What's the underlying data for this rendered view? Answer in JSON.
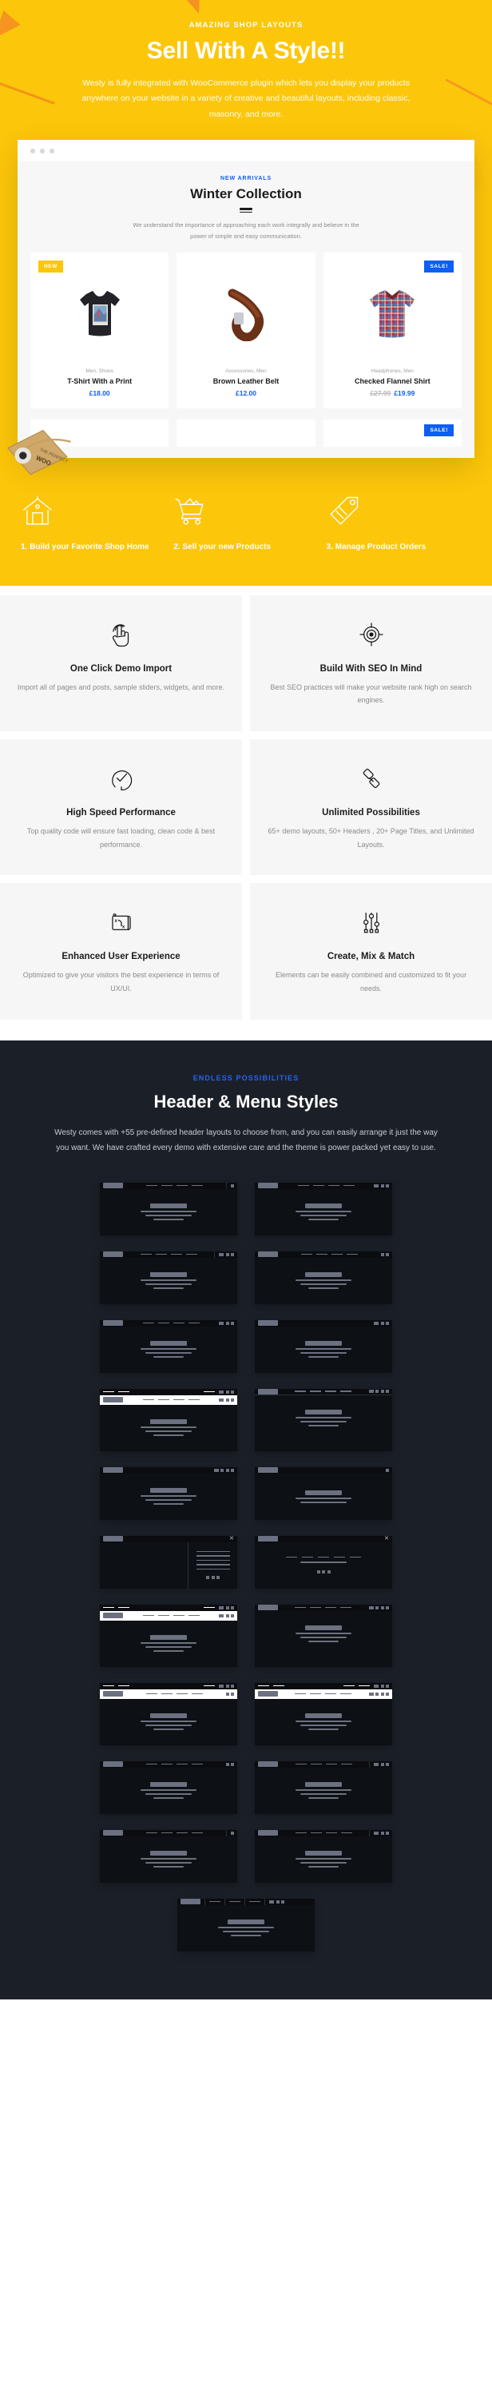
{
  "hero": {
    "eyebrow": "AMAZING SHOP LAYOUTS",
    "title": "Sell With A Style!!",
    "subtitle": "Westy is fully integrated with WooCommerce plugin which lets you display your products anywhere on your website in a variety of creative and beautiful layouts, including classic, masonry, and more."
  },
  "shop": {
    "eyebrow": "NEW ARRIVALS",
    "title": "Winter Collection",
    "description": "We understand the importance of approaching each work integrally and believe in the power of simple and easy communication.",
    "products": [
      {
        "badge": "NEW",
        "badge_type": "new",
        "category": "Men, Shoes",
        "name": "T-Shirt With a Print",
        "price": "£18.00",
        "old_price": ""
      },
      {
        "badge": "",
        "badge_type": "",
        "category": "Accessories, Men",
        "name": "Brown Leather Belt",
        "price": "£12.00",
        "old_price": ""
      },
      {
        "badge": "SALE!",
        "badge_type": "sale",
        "category": "Headphones, Men",
        "name": "Checked Flannel Shirt",
        "price": "£19.99",
        "old_price": "£27.99"
      }
    ],
    "products_row2": [
      {
        "badge": "",
        "badge_type": ""
      },
      {
        "badge": "",
        "badge_type": ""
      },
      {
        "badge": "SALE!",
        "badge_type": "sale"
      }
    ]
  },
  "steps": [
    {
      "icon": "house-icon",
      "label": "1. Build your Favorite Shop Home"
    },
    {
      "icon": "shopping-cart-icon",
      "label": "2. Sell your new Products"
    },
    {
      "icon": "price-tag-icon",
      "label": "3. Manage Product Orders"
    }
  ],
  "features": [
    {
      "icon": "click-finger-icon",
      "title": "One Click Demo Import",
      "desc": "Import all of pages and posts, sample sliders, widgets, and more."
    },
    {
      "icon": "target-icon",
      "title": "Build With SEO In Mind",
      "desc": "Best SEO practices will make your website rank high on search engines."
    },
    {
      "icon": "speed-check-icon",
      "title": "High Speed Performance",
      "desc": "Top quality code will ensure fast loading, clean code & best performance."
    },
    {
      "icon": "link-chain-icon",
      "title": "Unlimited Possibilities",
      "desc": "65+ demo layouts, 50+ Headers , 20+ Page Titles, and Unlimited Layouts."
    },
    {
      "icon": "folder-x-icon",
      "title": "Enhanced User Experience",
      "desc": "Optimized to give your visitors the best experience in terms of UX/UI."
    },
    {
      "icon": "sliders-icon",
      "title": "Create, Mix & Match",
      "desc": "Elements can be easily combined and customized to fit your needs."
    }
  ],
  "dark": {
    "eyebrow": "ENDLESS POSSIBILITIES",
    "title": "Header & Menu Styles",
    "subtitle": "Westy comes with +55 pre-defined header layouts to choose from, and you can easily arrange it just the way you want. We have crafted every demo with extensive care and the theme is power packed yet easy to use.",
    "thumbnails": [
      {
        "variant": "dark-split",
        "menu_items": 4,
        "icons": 1,
        "split": true
      },
      {
        "variant": "dark",
        "menu_items": 4,
        "icons": 3,
        "split": false
      },
      {
        "variant": "dark-split",
        "menu_items": 4,
        "icons": 3,
        "split": true
      },
      {
        "variant": "dark",
        "menu_items": 4,
        "icons": 2,
        "split": false
      },
      {
        "variant": "dark",
        "menu_items": 4,
        "icons": 3,
        "split": false
      },
      {
        "variant": "dark-right",
        "menu_items": 0,
        "icons": 3,
        "split": false
      },
      {
        "variant": "topbar-light",
        "menu_items": 4,
        "icons": 3,
        "split": false
      },
      {
        "variant": "dark-rule",
        "menu_items": 4,
        "icons": 4,
        "split": false
      },
      {
        "variant": "dark-right2",
        "menu_items": 0,
        "icons": 4,
        "split": false
      },
      {
        "variant": "sidepanel-a",
        "menu_items": 0,
        "icons": 1,
        "split": false
      },
      {
        "variant": "sidepanel-b",
        "menu_items": 0,
        "icons": 3,
        "split": false
      },
      {
        "variant": "sidepanel-c",
        "menu_items": 5,
        "icons": 3,
        "split": false
      },
      {
        "variant": "topbar-light",
        "menu_items": 4,
        "icons": 3,
        "split": false
      },
      {
        "variant": "dark",
        "menu_items": 4,
        "icons": 4,
        "split": false
      },
      {
        "variant": "topbar-light",
        "menu_items": 4,
        "icons": 2,
        "split": false
      },
      {
        "variant": "topbar-light2",
        "menu_items": 4,
        "icons": 4,
        "split": false
      },
      {
        "variant": "dark",
        "menu_items": 4,
        "icons": 2,
        "split": false
      },
      {
        "variant": "dark-split",
        "menu_items": 4,
        "icons": 3,
        "split": true
      },
      {
        "variant": "dark-split",
        "menu_items": 4,
        "icons": 1,
        "split": true
      },
      {
        "variant": "dark-split",
        "menu_items": 4,
        "icons": 3,
        "split": true
      },
      {
        "variant": "dark-cols",
        "menu_items": 3,
        "icons": 3,
        "split": true
      }
    ]
  },
  "colors": {
    "yellow": "#fcc60a",
    "blue": "#0d5ef4",
    "dark": "#1b2028",
    "thumb_dark": "#0d1014"
  }
}
